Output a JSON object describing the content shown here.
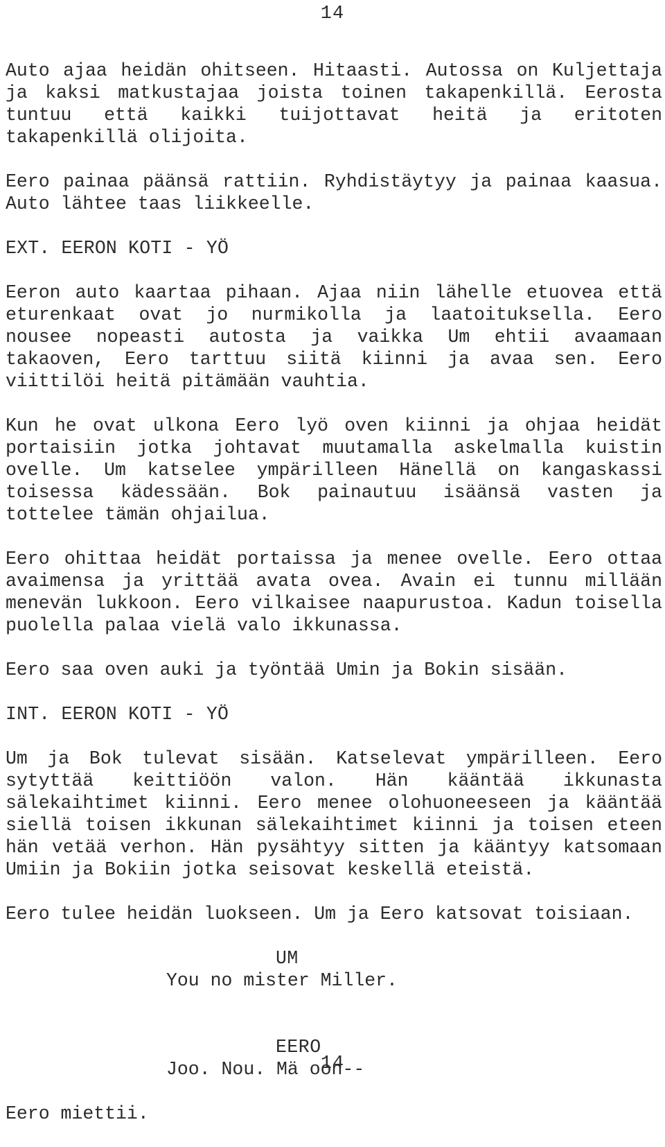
{
  "document": {
    "type": "screenplay-page",
    "language": "fi",
    "page_number_top": "14",
    "page_number_bottom": "14",
    "text_color": "#2b2b2b",
    "background_color": "#ffffff"
  },
  "blocks": {
    "action_1": "Auto ajaa heidän ohitseen. Hitaasti. Autossa on Kuljettaja ja kaksi matkustajaa joista toinen takapenkillä. Eerosta tuntuu että kaikki tuijottavat heitä ja eritoten takapenkillä olijoita.",
    "action_2": "Eero painaa päänsä rattiin. Ryhdistäytyy ja painaa kaasua. Auto lähtee taas liikkeelle.",
    "slug_1": "EXT. EERON KOTI - YÖ",
    "action_3": "Eeron auto kaartaa pihaan. Ajaa niin lähelle etuovea että eturenkaat ovat jo nurmikolla ja laatoituksella. Eero nousee nopeasti autosta ja vaikka Um ehtii avaamaan takaoven, Eero tarttuu siitä kiinni ja avaa sen. Eero viittilöi heitä pitämään vauhtia.",
    "action_4": "Kun he ovat ulkona Eero lyö oven kiinni ja ohjaa heidät portaisiin jotka johtavat muutamalla askelmalla kuistin ovelle. Um katselee ympärilleen Hänellä on kangaskassi toisessa kädessään. Bok painautuu isäänsä vasten ja tottelee tämän ohjailua.",
    "action_5": "Eero ohittaa heidät portaissa ja menee ovelle. Eero ottaa avaimensa ja yrittää avata ovea. Avain ei tunnu millään menevän lukkoon. Eero vilkaisee naapurustoa. Kadun toisella puolella palaa vielä valo ikkunassa.",
    "action_6": "Eero saa oven auki ja työntää Umin ja Bokin sisään.",
    "slug_2": "INT. EERON KOTI - YÖ",
    "action_7": "Um ja Bok tulevat sisään. Katselevat ympärilleen. Eero sytyttää keittiöön valon. Hän kääntää ikkunasta sälekaihtimet kiinni. Eero menee olohuoneeseen ja kääntää siellä toisen ikkunan sälekaihtimet kiinni ja toisen eteen hän vetää verhon. Hän pysähtyy sitten ja kääntyy katsomaan Umiin ja Bokiin jotka seisovat keskellä eteistä.",
    "action_8": "Eero tulee heidän luokseen. Um ja Eero katsovat toisiaan.",
    "dialogue_1": {
      "character": "UM",
      "line": "You no mister Miller."
    },
    "dialogue_2": {
      "character": "EERO",
      "line": "Joo. Nou. Mä oon--"
    },
    "action_9": "Eero miettii."
  }
}
